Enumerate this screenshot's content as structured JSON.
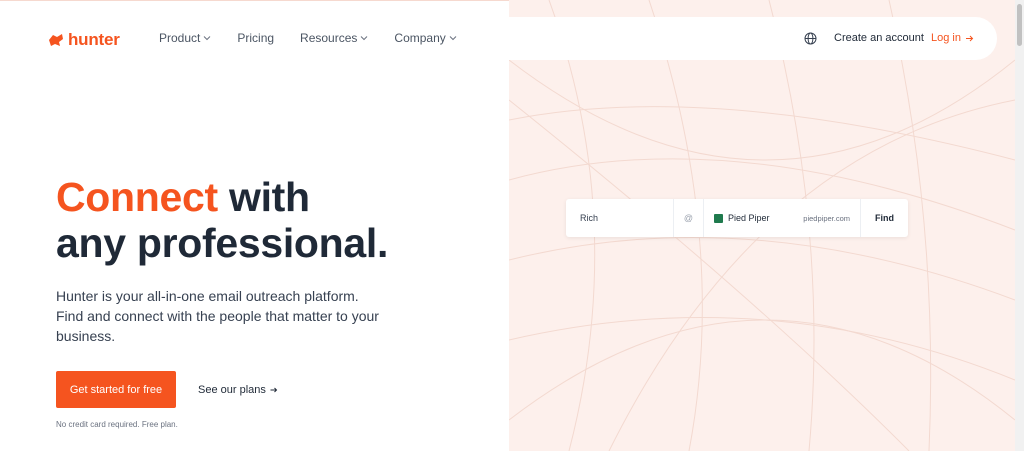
{
  "brand": {
    "name": "hunter",
    "accent_color": "#f5541f",
    "panel_color": "#fdf0ec"
  },
  "nav": {
    "items": [
      {
        "label": "Product",
        "has_dropdown": true
      },
      {
        "label": "Pricing",
        "has_dropdown": false
      },
      {
        "label": "Resources",
        "has_dropdown": true
      },
      {
        "label": "Company",
        "has_dropdown": true
      }
    ],
    "language_icon": "globe-icon",
    "create_account": "Create an account",
    "login": "Log in"
  },
  "hero": {
    "headline_accent": "Connect",
    "headline_rest_line1": " with",
    "headline_line2": "any professional.",
    "subtext": "Hunter is your all-in-one email outreach platform. Find and connect with the people that matter to your business.",
    "cta_primary": "Get started for free",
    "cta_secondary": "See our plans",
    "fineprint": "No credit card required. Free plan."
  },
  "finder": {
    "name_value": "Rich",
    "at_symbol": "@",
    "company_name": "Pied Piper",
    "company_domain": "piedpiper.com",
    "find_label": "Find"
  }
}
